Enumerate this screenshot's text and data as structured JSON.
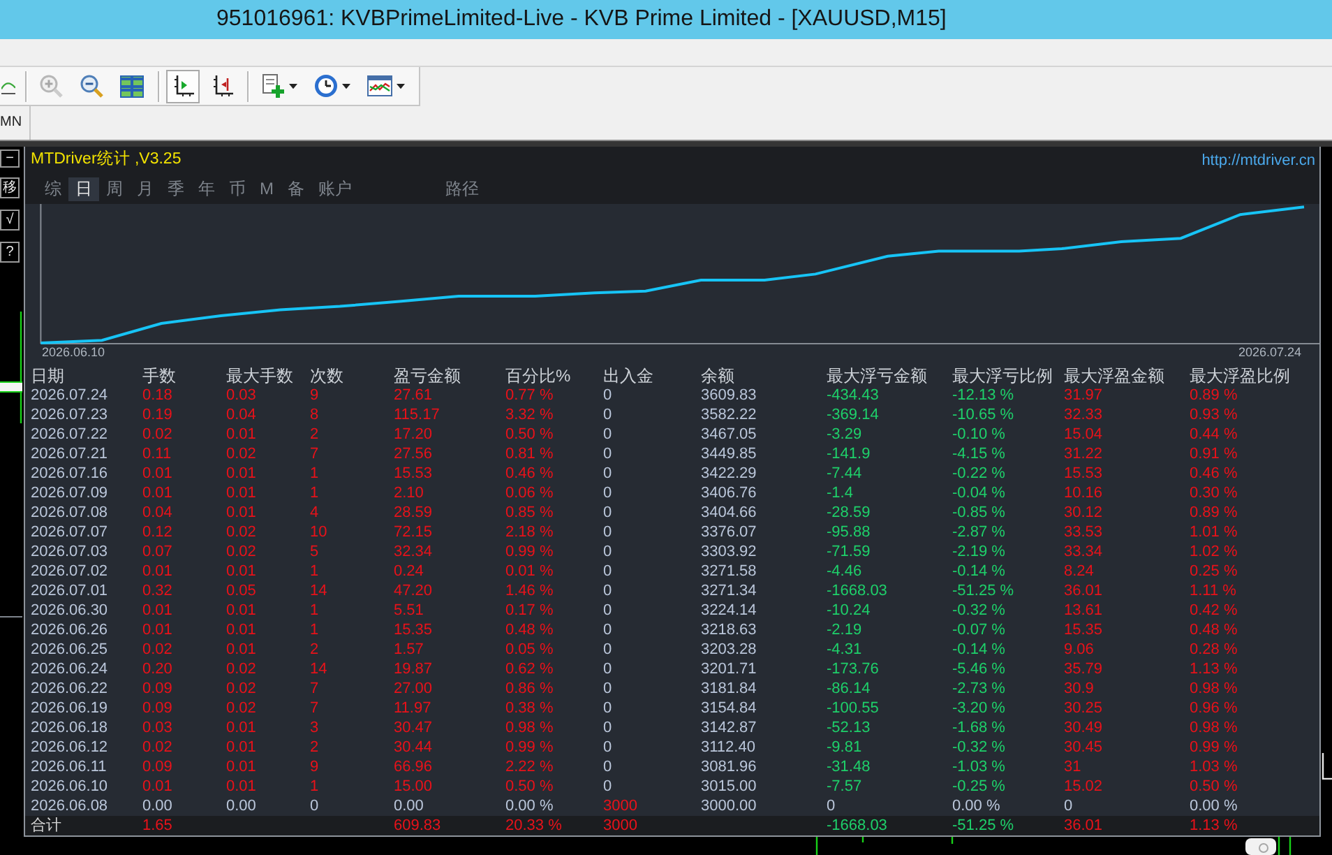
{
  "window": {
    "title": "951016961: KVBPrimeLimited-Live - KVB Prime Limited - [XAUUSD,M15]"
  },
  "toolbar": {
    "groups": [
      {
        "buttons": [
          {
            "pressed": false,
            "dropdown": false,
            "disabled": false
          }
        ]
      },
      {
        "buttons": [
          {
            "pressed": false,
            "dropdown": false,
            "disabled": true
          },
          {
            "pressed": false,
            "dropdown": false,
            "disabled": false
          },
          {
            "pressed": false,
            "dropdown": false,
            "disabled": false
          }
        ]
      },
      {
        "buttons": [
          {
            "pressed": true,
            "dropdown": false,
            "disabled": false
          },
          {
            "pressed": false,
            "dropdown": false,
            "disabled": false
          }
        ]
      },
      {
        "buttons": [
          {
            "pressed": false,
            "dropdown": true,
            "disabled": false
          },
          {
            "pressed": false,
            "dropdown": true,
            "disabled": false
          },
          {
            "pressed": false,
            "dropdown": true,
            "disabled": false
          }
        ]
      }
    ]
  },
  "periods_bar": {
    "items": [
      "MN"
    ]
  },
  "side_buttons": [
    "−",
    "移",
    "√",
    "?"
  ],
  "stats_panel": {
    "title": "MTDriver统计 ,V3.25",
    "link": "http://mtdriver.cn",
    "tabs": [
      {
        "label": "综",
        "selected": false
      },
      {
        "label": "日",
        "selected": true
      },
      {
        "label": "周",
        "selected": false
      },
      {
        "label": "月",
        "selected": false
      },
      {
        "label": "季",
        "selected": false
      },
      {
        "label": "年",
        "selected": false
      },
      {
        "label": "币",
        "selected": false
      },
      {
        "label": "M",
        "selected": false
      },
      {
        "label": "备",
        "selected": false
      },
      {
        "label": "账户",
        "selected": false
      },
      {
        "label": "路径",
        "selected": false
      }
    ],
    "chart": {
      "start_label": "2026.06.10",
      "end_label": "2026.07.24"
    },
    "table": {
      "columns": [
        "日期",
        "手数",
        "最大手数",
        "次数",
        "盈亏金额",
        "百分比%",
        "出入金",
        "余额",
        "最大浮亏金额",
        "最大浮亏比例",
        "最大浮盈金额",
        "最大浮盈比例"
      ],
      "rows": [
        {
          "kind": "day",
          "cells": [
            {
              "text": "2026.07.24",
              "color": "#bac6da"
            },
            {
              "text": "0.18",
              "color": "#e8121a"
            },
            {
              "text": "0.03",
              "color": "#e8121a"
            },
            {
              "text": "9",
              "color": "#e8121a"
            },
            {
              "text": "27.61",
              "color": "#e8121a"
            },
            {
              "text": "0.77 %",
              "color": "#e8121a"
            },
            {
              "text": "0",
              "color": "#bac6da"
            },
            {
              "text": "3609.83",
              "color": "#bac6da"
            },
            {
              "text": "-434.43",
              "color": "#1ed06a"
            },
            {
              "text": "-12.13 %",
              "color": "#1ed06a"
            },
            {
              "text": "31.97",
              "color": "#e8121a"
            },
            {
              "text": "0.89 %",
              "color": "#e8121a"
            }
          ]
        },
        {
          "kind": "day",
          "cells": [
            {
              "text": "2026.07.23",
              "color": "#bac6da"
            },
            {
              "text": "0.19",
              "color": "#e8121a"
            },
            {
              "text": "0.04",
              "color": "#e8121a"
            },
            {
              "text": "8",
              "color": "#e8121a"
            },
            {
              "text": "115.17",
              "color": "#e8121a"
            },
            {
              "text": "3.32 %",
              "color": "#e8121a"
            },
            {
              "text": "0",
              "color": "#bac6da"
            },
            {
              "text": "3582.22",
              "color": "#bac6da"
            },
            {
              "text": "-369.14",
              "color": "#1ed06a"
            },
            {
              "text": "-10.65 %",
              "color": "#1ed06a"
            },
            {
              "text": "32.33",
              "color": "#e8121a"
            },
            {
              "text": "0.93 %",
              "color": "#e8121a"
            }
          ]
        },
        {
          "kind": "day",
          "cells": [
            {
              "text": "2026.07.22",
              "color": "#bac6da"
            },
            {
              "text": "0.02",
              "color": "#e8121a"
            },
            {
              "text": "0.01",
              "color": "#e8121a"
            },
            {
              "text": "2",
              "color": "#e8121a"
            },
            {
              "text": "17.20",
              "color": "#e8121a"
            },
            {
              "text": "0.50 %",
              "color": "#e8121a"
            },
            {
              "text": "0",
              "color": "#bac6da"
            },
            {
              "text": "3467.05",
              "color": "#bac6da"
            },
            {
              "text": "-3.29",
              "color": "#1ed06a"
            },
            {
              "text": "-0.10 %",
              "color": "#1ed06a"
            },
            {
              "text": "15.04",
              "color": "#e8121a"
            },
            {
              "text": "0.44 %",
              "color": "#e8121a"
            }
          ]
        },
        {
          "kind": "day",
          "cells": [
            {
              "text": "2026.07.21",
              "color": "#bac6da"
            },
            {
              "text": "0.11",
              "color": "#e8121a"
            },
            {
              "text": "0.02",
              "color": "#e8121a"
            },
            {
              "text": "7",
              "color": "#e8121a"
            },
            {
              "text": "27.56",
              "color": "#e8121a"
            },
            {
              "text": "0.81 %",
              "color": "#e8121a"
            },
            {
              "text": "0",
              "color": "#bac6da"
            },
            {
              "text": "3449.85",
              "color": "#bac6da"
            },
            {
              "text": "-141.9",
              "color": "#1ed06a"
            },
            {
              "text": "-4.15 %",
              "color": "#1ed06a"
            },
            {
              "text": "31.22",
              "color": "#e8121a"
            },
            {
              "text": "0.91 %",
              "color": "#e8121a"
            }
          ]
        },
        {
          "kind": "day",
          "cells": [
            {
              "text": "2026.07.16",
              "color": "#bac6da"
            },
            {
              "text": "0.01",
              "color": "#e8121a"
            },
            {
              "text": "0.01",
              "color": "#e8121a"
            },
            {
              "text": "1",
              "color": "#e8121a"
            },
            {
              "text": "15.53",
              "color": "#e8121a"
            },
            {
              "text": "0.46 %",
              "color": "#e8121a"
            },
            {
              "text": "0",
              "color": "#bac6da"
            },
            {
              "text": "3422.29",
              "color": "#bac6da"
            },
            {
              "text": "-7.44",
              "color": "#1ed06a"
            },
            {
              "text": "-0.22 %",
              "color": "#1ed06a"
            },
            {
              "text": "15.53",
              "color": "#e8121a"
            },
            {
              "text": "0.46 %",
              "color": "#e8121a"
            }
          ]
        },
        {
          "kind": "day",
          "cells": [
            {
              "text": "2026.07.09",
              "color": "#bac6da"
            },
            {
              "text": "0.01",
              "color": "#e8121a"
            },
            {
              "text": "0.01",
              "color": "#e8121a"
            },
            {
              "text": "1",
              "color": "#e8121a"
            },
            {
              "text": "2.10",
              "color": "#e8121a"
            },
            {
              "text": "0.06 %",
              "color": "#e8121a"
            },
            {
              "text": "0",
              "color": "#bac6da"
            },
            {
              "text": "3406.76",
              "color": "#bac6da"
            },
            {
              "text": "-1.4",
              "color": "#1ed06a"
            },
            {
              "text": "-0.04 %",
              "color": "#1ed06a"
            },
            {
              "text": "10.16",
              "color": "#e8121a"
            },
            {
              "text": "0.30 %",
              "color": "#e8121a"
            }
          ]
        },
        {
          "kind": "day",
          "cells": [
            {
              "text": "2026.07.08",
              "color": "#bac6da"
            },
            {
              "text": "0.04",
              "color": "#e8121a"
            },
            {
              "text": "0.01",
              "color": "#e8121a"
            },
            {
              "text": "4",
              "color": "#e8121a"
            },
            {
              "text": "28.59",
              "color": "#e8121a"
            },
            {
              "text": "0.85 %",
              "color": "#e8121a"
            },
            {
              "text": "0",
              "color": "#bac6da"
            },
            {
              "text": "3404.66",
              "color": "#bac6da"
            },
            {
              "text": "-28.59",
              "color": "#1ed06a"
            },
            {
              "text": "-0.85 %",
              "color": "#1ed06a"
            },
            {
              "text": "30.12",
              "color": "#e8121a"
            },
            {
              "text": "0.89 %",
              "color": "#e8121a"
            }
          ]
        },
        {
          "kind": "day",
          "cells": [
            {
              "text": "2026.07.07",
              "color": "#bac6da"
            },
            {
              "text": "0.12",
              "color": "#e8121a"
            },
            {
              "text": "0.02",
              "color": "#e8121a"
            },
            {
              "text": "10",
              "color": "#e8121a"
            },
            {
              "text": "72.15",
              "color": "#e8121a"
            },
            {
              "text": "2.18 %",
              "color": "#e8121a"
            },
            {
              "text": "0",
              "color": "#bac6da"
            },
            {
              "text": "3376.07",
              "color": "#bac6da"
            },
            {
              "text": "-95.88",
              "color": "#1ed06a"
            },
            {
              "text": "-2.87 %",
              "color": "#1ed06a"
            },
            {
              "text": "33.53",
              "color": "#e8121a"
            },
            {
              "text": "1.01 %",
              "color": "#e8121a"
            }
          ]
        },
        {
          "kind": "day",
          "cells": [
            {
              "text": "2026.07.03",
              "color": "#bac6da"
            },
            {
              "text": "0.07",
              "color": "#e8121a"
            },
            {
              "text": "0.02",
              "color": "#e8121a"
            },
            {
              "text": "5",
              "color": "#e8121a"
            },
            {
              "text": "32.34",
              "color": "#e8121a"
            },
            {
              "text": "0.99 %",
              "color": "#e8121a"
            },
            {
              "text": "0",
              "color": "#bac6da"
            },
            {
              "text": "3303.92",
              "color": "#bac6da"
            },
            {
              "text": "-71.59",
              "color": "#1ed06a"
            },
            {
              "text": "-2.19 %",
              "color": "#1ed06a"
            },
            {
              "text": "33.34",
              "color": "#e8121a"
            },
            {
              "text": "1.02 %",
              "color": "#e8121a"
            }
          ]
        },
        {
          "kind": "day",
          "cells": [
            {
              "text": "2026.07.02",
              "color": "#bac6da"
            },
            {
              "text": "0.01",
              "color": "#e8121a"
            },
            {
              "text": "0.01",
              "color": "#e8121a"
            },
            {
              "text": "1",
              "color": "#e8121a"
            },
            {
              "text": "0.24",
              "color": "#e8121a"
            },
            {
              "text": "0.01 %",
              "color": "#e8121a"
            },
            {
              "text": "0",
              "color": "#bac6da"
            },
            {
              "text": "3271.58",
              "color": "#bac6da"
            },
            {
              "text": "-4.46",
              "color": "#1ed06a"
            },
            {
              "text": "-0.14 %",
              "color": "#1ed06a"
            },
            {
              "text": "8.24",
              "color": "#e8121a"
            },
            {
              "text": "0.25 %",
              "color": "#e8121a"
            }
          ]
        },
        {
          "kind": "day",
          "cells": [
            {
              "text": "2026.07.01",
              "color": "#bac6da"
            },
            {
              "text": "0.32",
              "color": "#e8121a"
            },
            {
              "text": "0.05",
              "color": "#e8121a"
            },
            {
              "text": "14",
              "color": "#e8121a"
            },
            {
              "text": "47.20",
              "color": "#e8121a"
            },
            {
              "text": "1.46 %",
              "color": "#e8121a"
            },
            {
              "text": "0",
              "color": "#bac6da"
            },
            {
              "text": "3271.34",
              "color": "#bac6da"
            },
            {
              "text": "-1668.03",
              "color": "#1ed06a"
            },
            {
              "text": "-51.25 %",
              "color": "#1ed06a"
            },
            {
              "text": "36.01",
              "color": "#e8121a"
            },
            {
              "text": "1.11 %",
              "color": "#e8121a"
            }
          ]
        },
        {
          "kind": "day",
          "cells": [
            {
              "text": "2026.06.30",
              "color": "#bac6da"
            },
            {
              "text": "0.01",
              "color": "#e8121a"
            },
            {
              "text": "0.01",
              "color": "#e8121a"
            },
            {
              "text": "1",
              "color": "#e8121a"
            },
            {
              "text": "5.51",
              "color": "#e8121a"
            },
            {
              "text": "0.17 %",
              "color": "#e8121a"
            },
            {
              "text": "0",
              "color": "#bac6da"
            },
            {
              "text": "3224.14",
              "color": "#bac6da"
            },
            {
              "text": "-10.24",
              "color": "#1ed06a"
            },
            {
              "text": "-0.32 %",
              "color": "#1ed06a"
            },
            {
              "text": "13.61",
              "color": "#e8121a"
            },
            {
              "text": "0.42 %",
              "color": "#e8121a"
            }
          ]
        },
        {
          "kind": "day",
          "cells": [
            {
              "text": "2026.06.26",
              "color": "#bac6da"
            },
            {
              "text": "0.01",
              "color": "#e8121a"
            },
            {
              "text": "0.01",
              "color": "#e8121a"
            },
            {
              "text": "1",
              "color": "#e8121a"
            },
            {
              "text": "15.35",
              "color": "#e8121a"
            },
            {
              "text": "0.48 %",
              "color": "#e8121a"
            },
            {
              "text": "0",
              "color": "#bac6da"
            },
            {
              "text": "3218.63",
              "color": "#bac6da"
            },
            {
              "text": "-2.19",
              "color": "#1ed06a"
            },
            {
              "text": "-0.07 %",
              "color": "#1ed06a"
            },
            {
              "text": "15.35",
              "color": "#e8121a"
            },
            {
              "text": "0.48 %",
              "color": "#e8121a"
            }
          ]
        },
        {
          "kind": "day",
          "cells": [
            {
              "text": "2026.06.25",
              "color": "#bac6da"
            },
            {
              "text": "0.02",
              "color": "#e8121a"
            },
            {
              "text": "0.01",
              "color": "#e8121a"
            },
            {
              "text": "2",
              "color": "#e8121a"
            },
            {
              "text": "1.57",
              "color": "#e8121a"
            },
            {
              "text": "0.05 %",
              "color": "#e8121a"
            },
            {
              "text": "0",
              "color": "#bac6da"
            },
            {
              "text": "3203.28",
              "color": "#bac6da"
            },
            {
              "text": "-4.31",
              "color": "#1ed06a"
            },
            {
              "text": "-0.14 %",
              "color": "#1ed06a"
            },
            {
              "text": "9.06",
              "color": "#e8121a"
            },
            {
              "text": "0.28 %",
              "color": "#e8121a"
            }
          ]
        },
        {
          "kind": "day",
          "cells": [
            {
              "text": "2026.06.24",
              "color": "#bac6da"
            },
            {
              "text": "0.20",
              "color": "#e8121a"
            },
            {
              "text": "0.02",
              "color": "#e8121a"
            },
            {
              "text": "14",
              "color": "#e8121a"
            },
            {
              "text": "19.87",
              "color": "#e8121a"
            },
            {
              "text": "0.62 %",
              "color": "#e8121a"
            },
            {
              "text": "0",
              "color": "#bac6da"
            },
            {
              "text": "3201.71",
              "color": "#bac6da"
            },
            {
              "text": "-173.76",
              "color": "#1ed06a"
            },
            {
              "text": "-5.46 %",
              "color": "#1ed06a"
            },
            {
              "text": "35.79",
              "color": "#e8121a"
            },
            {
              "text": "1.13 %",
              "color": "#e8121a"
            }
          ]
        },
        {
          "kind": "day",
          "cells": [
            {
              "text": "2026.06.22",
              "color": "#bac6da"
            },
            {
              "text": "0.09",
              "color": "#e8121a"
            },
            {
              "text": "0.02",
              "color": "#e8121a"
            },
            {
              "text": "7",
              "color": "#e8121a"
            },
            {
              "text": "27.00",
              "color": "#e8121a"
            },
            {
              "text": "0.86 %",
              "color": "#e8121a"
            },
            {
              "text": "0",
              "color": "#bac6da"
            },
            {
              "text": "3181.84",
              "color": "#bac6da"
            },
            {
              "text": "-86.14",
              "color": "#1ed06a"
            },
            {
              "text": "-2.73 %",
              "color": "#1ed06a"
            },
            {
              "text": "30.9",
              "color": "#e8121a"
            },
            {
              "text": "0.98 %",
              "color": "#e8121a"
            }
          ]
        },
        {
          "kind": "day",
          "cells": [
            {
              "text": "2026.06.19",
              "color": "#bac6da"
            },
            {
              "text": "0.09",
              "color": "#e8121a"
            },
            {
              "text": "0.02",
              "color": "#e8121a"
            },
            {
              "text": "7",
              "color": "#e8121a"
            },
            {
              "text": "11.97",
              "color": "#e8121a"
            },
            {
              "text": "0.38 %",
              "color": "#e8121a"
            },
            {
              "text": "0",
              "color": "#bac6da"
            },
            {
              "text": "3154.84",
              "color": "#bac6da"
            },
            {
              "text": "-100.55",
              "color": "#1ed06a"
            },
            {
              "text": "-3.20 %",
              "color": "#1ed06a"
            },
            {
              "text": "30.25",
              "color": "#e8121a"
            },
            {
              "text": "0.96 %",
              "color": "#e8121a"
            }
          ]
        },
        {
          "kind": "day",
          "cells": [
            {
              "text": "2026.06.18",
              "color": "#bac6da"
            },
            {
              "text": "0.03",
              "color": "#e8121a"
            },
            {
              "text": "0.01",
              "color": "#e8121a"
            },
            {
              "text": "3",
              "color": "#e8121a"
            },
            {
              "text": "30.47",
              "color": "#e8121a"
            },
            {
              "text": "0.98 %",
              "color": "#e8121a"
            },
            {
              "text": "0",
              "color": "#bac6da"
            },
            {
              "text": "3142.87",
              "color": "#bac6da"
            },
            {
              "text": "-52.13",
              "color": "#1ed06a"
            },
            {
              "text": "-1.68 %",
              "color": "#1ed06a"
            },
            {
              "text": "30.49",
              "color": "#e8121a"
            },
            {
              "text": "0.98 %",
              "color": "#e8121a"
            }
          ]
        },
        {
          "kind": "day",
          "cells": [
            {
              "text": "2026.06.12",
              "color": "#bac6da"
            },
            {
              "text": "0.02",
              "color": "#e8121a"
            },
            {
              "text": "0.01",
              "color": "#e8121a"
            },
            {
              "text": "2",
              "color": "#e8121a"
            },
            {
              "text": "30.44",
              "color": "#e8121a"
            },
            {
              "text": "0.99 %",
              "color": "#e8121a"
            },
            {
              "text": "0",
              "color": "#bac6da"
            },
            {
              "text": "3112.40",
              "color": "#bac6da"
            },
            {
              "text": "-9.81",
              "color": "#1ed06a"
            },
            {
              "text": "-0.32 %",
              "color": "#1ed06a"
            },
            {
              "text": "30.45",
              "color": "#e8121a"
            },
            {
              "text": "0.99 %",
              "color": "#e8121a"
            }
          ]
        },
        {
          "kind": "day",
          "cells": [
            {
              "text": "2026.06.11",
              "color": "#bac6da"
            },
            {
              "text": "0.09",
              "color": "#e8121a"
            },
            {
              "text": "0.01",
              "color": "#e8121a"
            },
            {
              "text": "9",
              "color": "#e8121a"
            },
            {
              "text": "66.96",
              "color": "#e8121a"
            },
            {
              "text": "2.22 %",
              "color": "#e8121a"
            },
            {
              "text": "0",
              "color": "#bac6da"
            },
            {
              "text": "3081.96",
              "color": "#bac6da"
            },
            {
              "text": "-31.48",
              "color": "#1ed06a"
            },
            {
              "text": "-1.03 %",
              "color": "#1ed06a"
            },
            {
              "text": "31",
              "color": "#e8121a"
            },
            {
              "text": "1.03 %",
              "color": "#e8121a"
            }
          ]
        },
        {
          "kind": "day",
          "cells": [
            {
              "text": "2026.06.10",
              "color": "#bac6da"
            },
            {
              "text": "0.01",
              "color": "#e8121a"
            },
            {
              "text": "0.01",
              "color": "#e8121a"
            },
            {
              "text": "1",
              "color": "#e8121a"
            },
            {
              "text": "15.00",
              "color": "#e8121a"
            },
            {
              "text": "0.50 %",
              "color": "#e8121a"
            },
            {
              "text": "0",
              "color": "#bac6da"
            },
            {
              "text": "3015.00",
              "color": "#bac6da"
            },
            {
              "text": "-7.57",
              "color": "#1ed06a"
            },
            {
              "text": "-0.25 %",
              "color": "#1ed06a"
            },
            {
              "text": "15.02",
              "color": "#e8121a"
            },
            {
              "text": "0.50 %",
              "color": "#e8121a"
            }
          ]
        },
        {
          "kind": "day",
          "cells": [
            {
              "text": "2026.06.08",
              "color": "#bac6da"
            },
            {
              "text": "0.00",
              "color": "#bac6da"
            },
            {
              "text": "0.00",
              "color": "#bac6da"
            },
            {
              "text": "0",
              "color": "#bac6da"
            },
            {
              "text": "0.00",
              "color": "#bac6da"
            },
            {
              "text": "0.00 %",
              "color": "#bac6da"
            },
            {
              "text": "3000",
              "color": "#e8121a"
            },
            {
              "text": "3000.00",
              "color": "#bac6da"
            },
            {
              "text": "0",
              "color": "#bac6da"
            },
            {
              "text": "0.00 %",
              "color": "#bac6da"
            },
            {
              "text": "0",
              "color": "#bac6da"
            },
            {
              "text": "0.00 %",
              "color": "#bac6da"
            }
          ]
        },
        {
          "kind": "total",
          "cells": [
            {
              "text": "合计",
              "color": "#d4d4d4"
            },
            {
              "text": "1.65",
              "color": "#e8121a"
            },
            null,
            null,
            {
              "text": "609.83",
              "color": "#e8121a"
            },
            {
              "text": "20.33 %",
              "color": "#e8121a"
            },
            {
              "text": "3000",
              "color": "#e8121a"
            },
            null,
            {
              "text": "-1668.03",
              "color": "#1ed06a"
            },
            {
              "text": "-51.25 %",
              "color": "#1ed06a"
            },
            {
              "text": "36.01",
              "color": "#e8121a"
            },
            {
              "text": "1.13 %",
              "color": "#e8121a"
            }
          ]
        }
      ]
    }
  }
}
